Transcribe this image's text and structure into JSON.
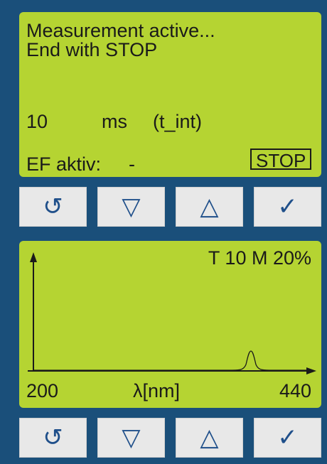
{
  "measurement": {
    "status_line1": "Measurement active...",
    "status_line2": "End with STOP",
    "t_int_value": "10",
    "t_int_unit": "ms",
    "t_int_label": "(t_int)",
    "ef_label": "EF aktiv:",
    "ef_value": "-",
    "stop_label": "STOP"
  },
  "buttons": {
    "reset": "↺",
    "down": "▽",
    "up": "△",
    "confirm": "✓"
  },
  "spectrum": {
    "header": "T 10  M  20%",
    "x_min": "200",
    "x_max": "440",
    "x_label": "λ[nm]"
  },
  "colors": {
    "background": "#1a4f7a",
    "lcd": "#b5d432",
    "button": "#e8e8e8",
    "button_icon": "#1f4f8a"
  },
  "icons": [
    "rotate-icon",
    "triangle-down-icon",
    "triangle-up-icon",
    "check-icon"
  ]
}
